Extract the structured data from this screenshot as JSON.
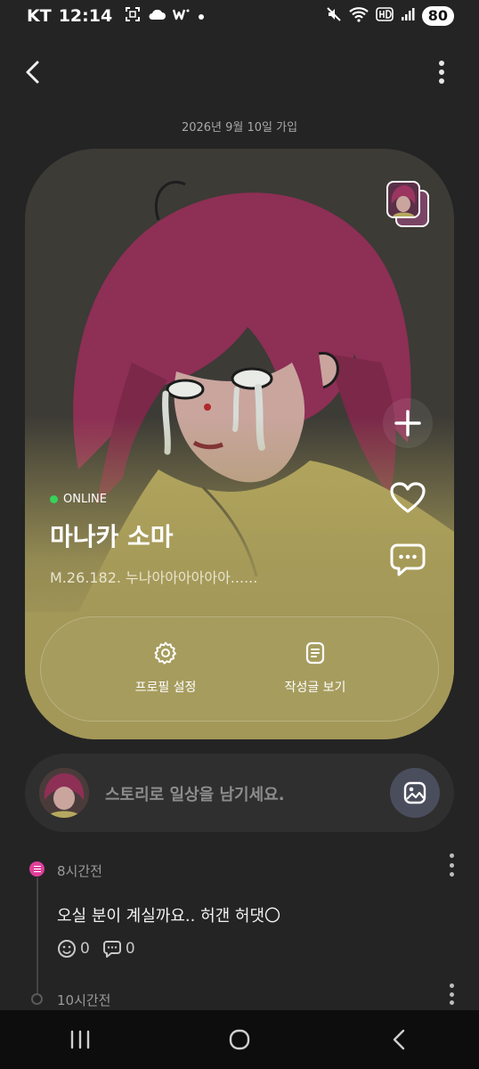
{
  "status_bar": {
    "carrier": "KT",
    "time": "12:14",
    "battery": "80"
  },
  "header": {
    "back_icon": "chevron-left-icon",
    "more_icon": "more-vertical-icon"
  },
  "join_date": "2026년 9월 10일 가입",
  "profile": {
    "online_label": "ONLINE",
    "name": "마나카 소마",
    "status_message": "M.26.182. 누나아아아아아아......",
    "actions": {
      "settings_label": "프로필 설정",
      "posts_label": "작성글 보기"
    }
  },
  "story": {
    "placeholder": "스토리로 일상을 남기세요."
  },
  "feed": [
    {
      "time": "8시간전",
      "text": "오실 분이 계실까요.. 허갠 허댓〇",
      "reactions": "0",
      "comments": "0"
    },
    {
      "time": "10시간전"
    }
  ],
  "colors": {
    "background": "#242424",
    "card_bottom": "#a39858",
    "online_dot": "#37d35a",
    "post_marker": "#e0409a"
  }
}
